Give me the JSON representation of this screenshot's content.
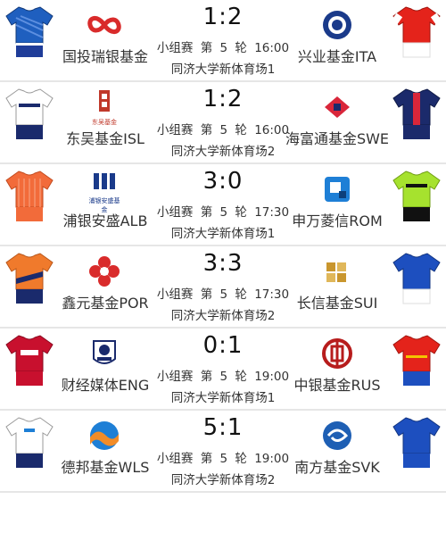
{
  "matches": [
    {
      "home": {
        "name": "国投瑞银基金",
        "jersey_color": "#1f5fbf",
        "shorts_color": "#1f3d99",
        "logo_color": "#d92b2b",
        "logo_icon": "infinity-logo-icon"
      },
      "away": {
        "name": "兴业基金ITA",
        "jersey_color": "#e4231b",
        "shorts_color": "#ffffff",
        "logo_color": "#1a3a8a",
        "logo_icon": "circle-emblem-logo-icon"
      },
      "score": "1:2",
      "stage": "小组赛",
      "round_prefix": "第",
      "round_num": "5",
      "round_suffix": "轮",
      "time": "16:00",
      "venue": "同济大学新体育场1"
    },
    {
      "home": {
        "name": "东吴基金ISL",
        "jersey_color": "#ffffff",
        "shorts_color": "#1a2a6c",
        "logo_color": "#c0392b",
        "logo_icon": "seal-logo-icon",
        "logo_text": "东吴基金"
      },
      "away": {
        "name": "海富通基金SWE",
        "jersey_color": "#1b2a6b",
        "shorts_color": "#1b2a6b",
        "logo_color": "#d9263a",
        "logo_icon": "diamond-logo-icon"
      },
      "score": "1:2",
      "stage": "小组赛",
      "round_prefix": "第",
      "round_num": "5",
      "round_suffix": "轮",
      "time": "16:00",
      "venue": "同济大学新体育场2"
    },
    {
      "home": {
        "name": "浦银安盛ALB",
        "jersey_color": "#f26b3a",
        "shorts_color": "#f26b3a",
        "logo_color": "#1a3a8a",
        "logo_icon": "spdb-logo-icon",
        "logo_text": "浦银安盛基金"
      },
      "away": {
        "name": "申万菱信ROM",
        "jersey_color": "#a6e22e",
        "shorts_color": "#111111",
        "logo_color": "#1e7fd6",
        "logo_icon": "square-logo-icon"
      },
      "score": "3:0",
      "stage": "小组赛",
      "round_prefix": "第",
      "round_num": "5",
      "round_suffix": "轮",
      "time": "17:30",
      "venue": "同济大学新体育场1"
    },
    {
      "home": {
        "name": "鑫元基金POR",
        "jersey_color": "#f07a2c",
        "shorts_color": "#1a2a6c",
        "logo_color": "#d92b2b",
        "logo_icon": "flower-logo-icon"
      },
      "away": {
        "name": "长信基金SUI",
        "jersey_color": "#1d4fbf",
        "shorts_color": "#ffffff",
        "logo_color": "#c9962e",
        "logo_icon": "cube-logo-icon"
      },
      "score": "3:3",
      "stage": "小组赛",
      "round_prefix": "第",
      "round_num": "5",
      "round_suffix": "轮",
      "time": "17:30",
      "venue": "同济大学新体育场2"
    },
    {
      "home": {
        "name": "财经媒体ENG",
        "jersey_color": "#c8102e",
        "shorts_color": "#c8102e",
        "logo_color": "#1a2a6c",
        "logo_icon": "lion-logo-icon"
      },
      "away": {
        "name": "中银基金RUS",
        "jersey_color": "#e4231b",
        "shorts_color": "#1d4fbf",
        "logo_color": "#b71c1c",
        "logo_icon": "coin-logo-icon"
      },
      "score": "0:1",
      "stage": "小组赛",
      "round_prefix": "第",
      "round_num": "5",
      "round_suffix": "轮",
      "time": "19:00",
      "venue": "同济大学新体育场1"
    },
    {
      "home": {
        "name": "德邦基金WLS",
        "jersey_color": "#ffffff",
        "shorts_color": "#1a2a6c",
        "logo_color": "#1e7fd6",
        "logo_icon": "wave-logo-icon"
      },
      "away": {
        "name": "南方基金SVK",
        "jersey_color": "#1d4fbf",
        "shorts_color": "#1d4fbf",
        "logo_color": "#1e5fb4",
        "logo_icon": "swirl-logo-icon"
      },
      "score": "5:1",
      "stage": "小组赛",
      "round_prefix": "第",
      "round_num": "5",
      "round_suffix": "轮",
      "time": "19:00",
      "venue": "同济大学新体育场2"
    }
  ]
}
